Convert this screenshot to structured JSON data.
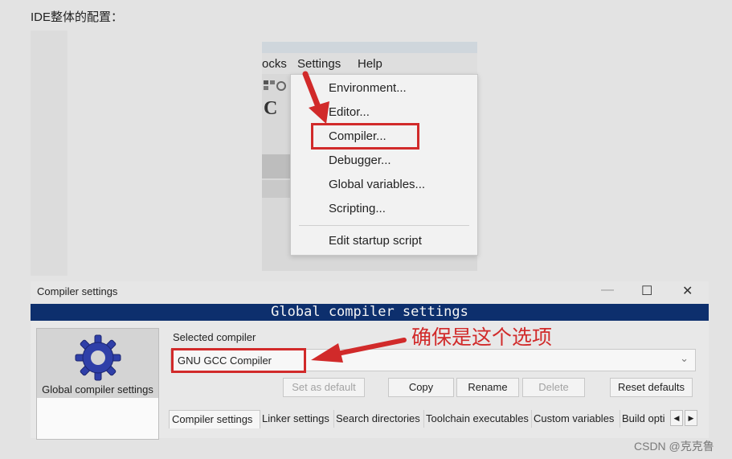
{
  "page": {
    "title": "IDE整体的配置："
  },
  "menu": {
    "menubar": [
      "ocks",
      "Settings",
      "Help"
    ],
    "toolbar_letter": "C",
    "items": [
      "Environment...",
      "Editor...",
      "Compiler...",
      "Debugger...",
      "Global variables...",
      "Scripting...",
      "Edit startup script"
    ]
  },
  "dialog": {
    "title": "Compiler settings",
    "window_buttons": [
      "—",
      "☐",
      "✕"
    ],
    "banner": "Global compiler settings",
    "left_panel_label": "Global compiler settings",
    "selected_compiler_label": "Selected compiler",
    "selected_compiler_value": "GNU GCC Compiler",
    "buttons": {
      "set_default": "Set as default",
      "copy": "Copy",
      "rename": "Rename",
      "delete": "Delete",
      "reset": "Reset defaults"
    },
    "tabs": [
      "Compiler settings",
      "Linker settings",
      "Search directories",
      "Toolchain executables",
      "Custom variables",
      "Build opti"
    ],
    "tab_scroll": [
      "◀",
      "▶"
    ]
  },
  "annotation": "确保是这个选项",
  "watermark": "CSDN @克克鲁",
  "colors": {
    "highlight": "#d12a2a",
    "banner": "#0d2f6d"
  }
}
